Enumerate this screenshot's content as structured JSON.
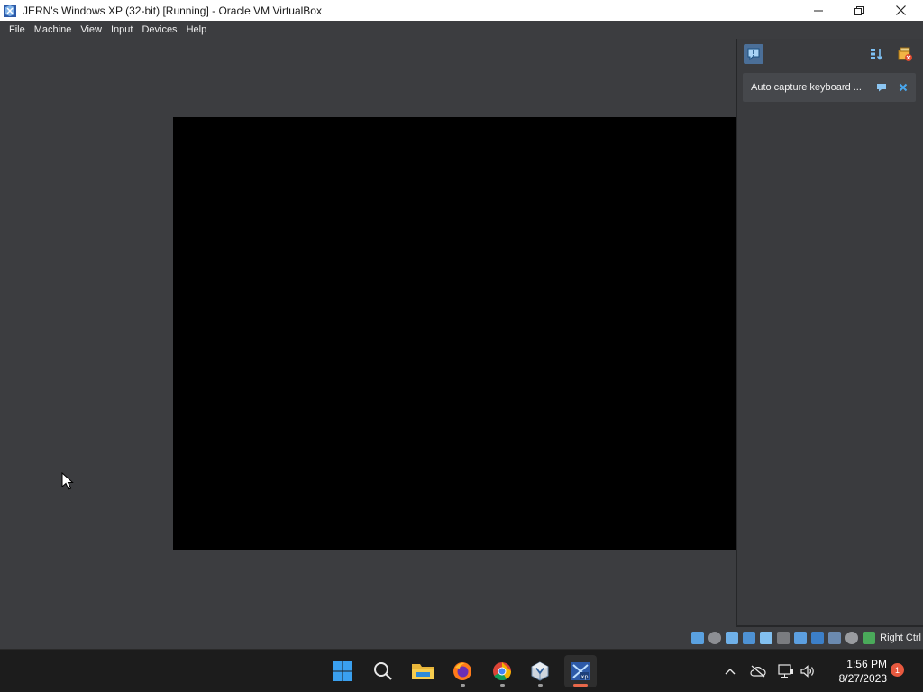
{
  "window": {
    "title": "JERN's Windows XP (32-bit) [Running] - Oracle VM VirtualBox",
    "controls": [
      "minimize",
      "maximize",
      "close"
    ]
  },
  "menubar": {
    "items": [
      {
        "label": "File"
      },
      {
        "label": "Machine"
      },
      {
        "label": "View"
      },
      {
        "label": "Input"
      },
      {
        "label": "Devices"
      },
      {
        "label": "Help"
      }
    ]
  },
  "notification_center": {
    "message": "Auto capture keyboard ..."
  },
  "statusbar": {
    "host_key": "Right Ctrl",
    "icons": [
      "hard-disk-icon",
      "optical-drive-icon",
      "audio-icon",
      "network-icon",
      "usb-icon",
      "shared-folders-icon",
      "display-icon",
      "video-capture-icon",
      "virtualization-icon",
      "mouse-integration-icon",
      "keyboard-capture-icon"
    ]
  },
  "taskbar": {
    "apps": [
      "start-icon",
      "search-icon",
      "file-explorer-icon",
      "firefox-icon",
      "chrome-icon",
      "virtualbox-manager-icon",
      "vm-window-icon"
    ],
    "clock_time": "1:56 PM",
    "clock_date": "8/27/2023",
    "notification_count": "1"
  },
  "colors": {
    "accent": "#e8684a",
    "vm_background": "#3c3d40",
    "screen": "#000000"
  }
}
